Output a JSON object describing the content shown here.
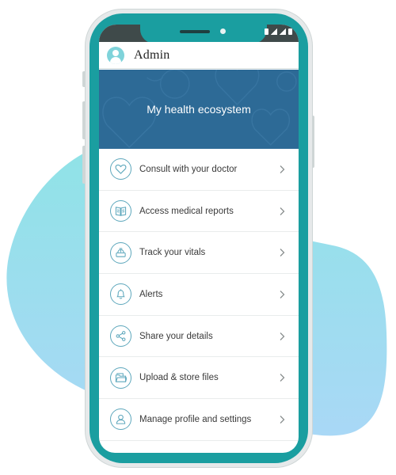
{
  "header": {
    "admin_name": "Admin"
  },
  "hero": {
    "title": "My health ecosystem"
  },
  "menu": {
    "items": [
      {
        "label": "Consult with your doctor",
        "icon": "heart-icon"
      },
      {
        "label": "Access medical reports",
        "icon": "report-book-icon"
      },
      {
        "label": "Track your vitals",
        "icon": "scale-icon"
      },
      {
        "label": "Alerts",
        "icon": "bell-icon"
      },
      {
        "label": "Share your details",
        "icon": "share-icon"
      },
      {
        "label": "Upload & store files",
        "icon": "folder-icon"
      },
      {
        "label": "Manage profile and settings",
        "icon": "user-icon"
      }
    ]
  },
  "colors": {
    "frame": "#1a9ea0",
    "hero": "#2d6a96",
    "icon_stroke": "#5da7bc",
    "blob_top": "#8fe3e6",
    "blob_bottom": "#a9d8f6"
  }
}
